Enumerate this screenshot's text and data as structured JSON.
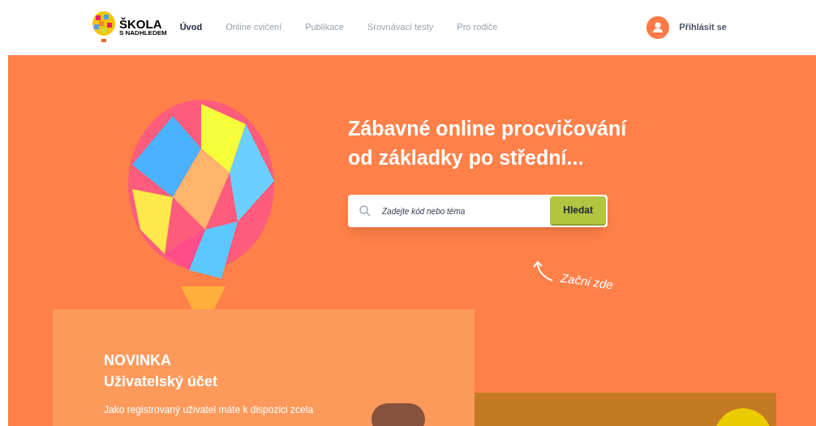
{
  "logo": {
    "line1": "ŠKOLA",
    "line2": "S NADHLEDEM"
  },
  "nav": [
    {
      "label": "Úvod",
      "selected": true
    },
    {
      "label": "Online cvičení",
      "selected": false
    },
    {
      "label": "Publikace",
      "selected": false
    },
    {
      "label": "Srovnávací testy",
      "selected": false
    },
    {
      "label": "Pro rodiče",
      "selected": false
    }
  ],
  "login": "Přihlásit se",
  "hero": {
    "title_line1": "Zábavné online procvičování",
    "title_line2": "od základky po střední...",
    "search": {
      "placeholder": "Zadejte kód nebo téma",
      "button": "Hledat"
    },
    "hint": "Začni zde"
  },
  "news_card": {
    "label": "NOVINKA",
    "title": "Uživatelský účet",
    "text": "Jako registrovaný uživatel máte k dispozici zcela"
  }
}
